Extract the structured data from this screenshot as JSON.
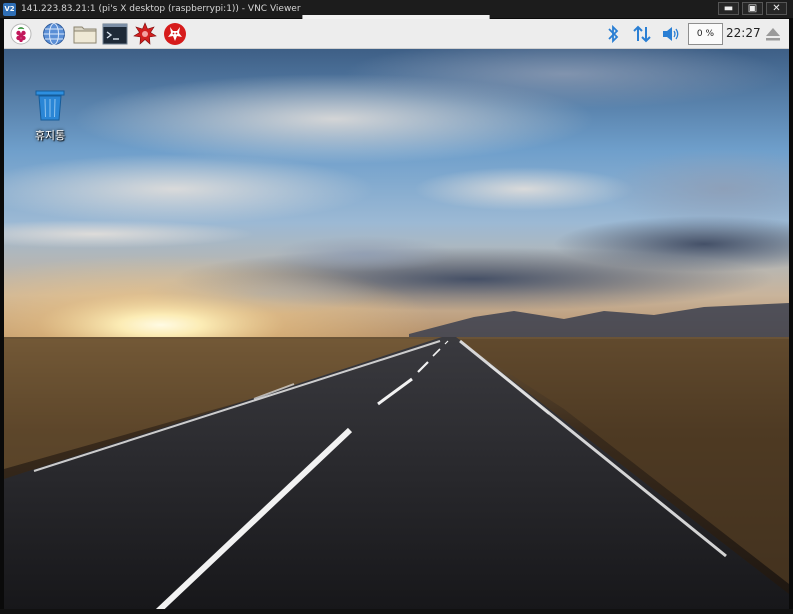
{
  "vnc_window": {
    "title": "141.223.83.21:1 (pi's X desktop (raspberrypi:1)) - VNC Viewer",
    "logo_text": "V2",
    "controls": [
      {
        "name": "minimize-button",
        "glyph": "▬"
      },
      {
        "name": "maximize-button",
        "glyph": "▣"
      },
      {
        "name": "close-button",
        "glyph": "✕"
      }
    ]
  },
  "taskbar": {
    "launchers": [
      {
        "name": "raspberry-menu-icon"
      },
      {
        "name": "web-browser-icon"
      },
      {
        "name": "file-manager-icon"
      },
      {
        "name": "terminal-icon"
      },
      {
        "name": "mathematica-icon"
      },
      {
        "name": "wolfram-icon"
      }
    ],
    "tray": {
      "bluetooth_icon": "bluetooth-icon",
      "network_icon": "network-icon",
      "volume_icon": "volume-icon",
      "cpu_usage": "0 %",
      "clock": "22:27",
      "eject_icon": "eject-icon"
    }
  },
  "desktop": {
    "icons": [
      {
        "label": "휴지통",
        "icon": "trash-icon"
      }
    ]
  },
  "colors": {
    "taskbar_bg": "#ededed",
    "tray_blue": "#2a7fd4",
    "vnc_titlebar": "#1c1c1c"
  }
}
